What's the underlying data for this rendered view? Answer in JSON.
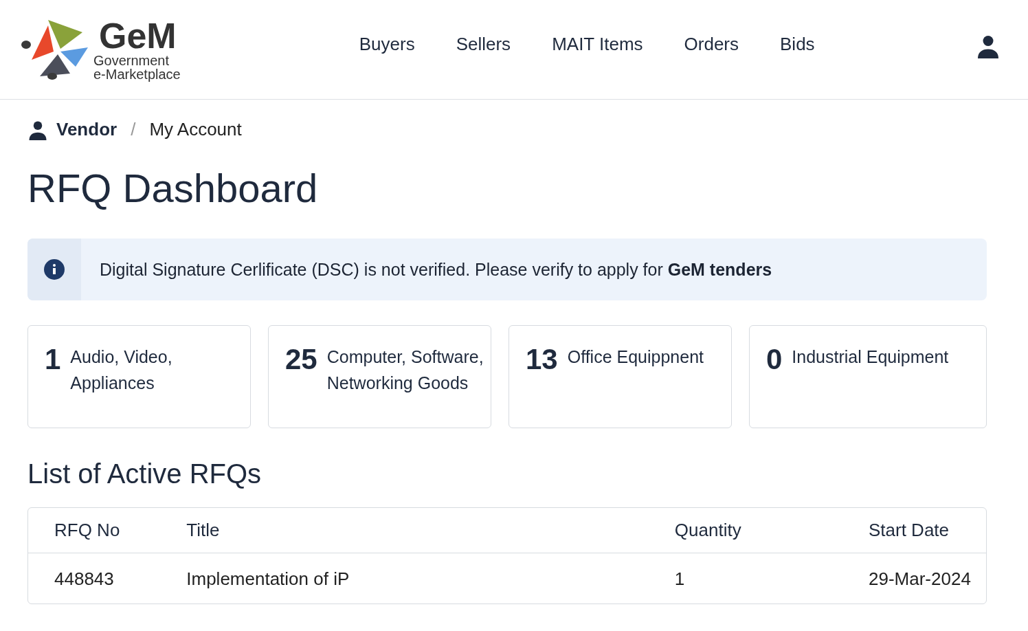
{
  "logo": {
    "name": "GeM",
    "line_1": "Government",
    "line_2": "e-Marketplace"
  },
  "nav": [
    {
      "label": "Buyers"
    },
    {
      "label": "Sellers"
    },
    {
      "label": "MAIT Items"
    },
    {
      "label": "Orders"
    },
    {
      "label": "Bids"
    }
  ],
  "breadcrumb": [
    {
      "label": "Vendor",
      "kind": "link"
    },
    {
      "label": "My Account",
      "kind": "current"
    }
  ],
  "breadcrumb_separator": "/",
  "page_title": "RFQ Dashboard",
  "alert": {
    "message": "Digital Signature Cerlificate (DSC) is not verified. Please verify to apply for **GeM tenders**"
  },
  "categories": [
    {
      "count": "1",
      "label": "Audio, Video, Appliances"
    },
    {
      "count": "25",
      "label": "Computer, Software, Networking Goods"
    },
    {
      "count": "13",
      "label": "Office Equippnent"
    },
    {
      "count": "0",
      "label": "Industrial Equipment"
    }
  ],
  "section_title": "List of Active RFQs",
  "table": {
    "columns": [
      "RFQ No",
      "Title",
      "Quantity",
      "Start Date"
    ],
    "rows": [
      [
        "448843",
        "Implementation of iP",
        "1",
        "29-Mar-2024"
      ]
    ]
  }
}
